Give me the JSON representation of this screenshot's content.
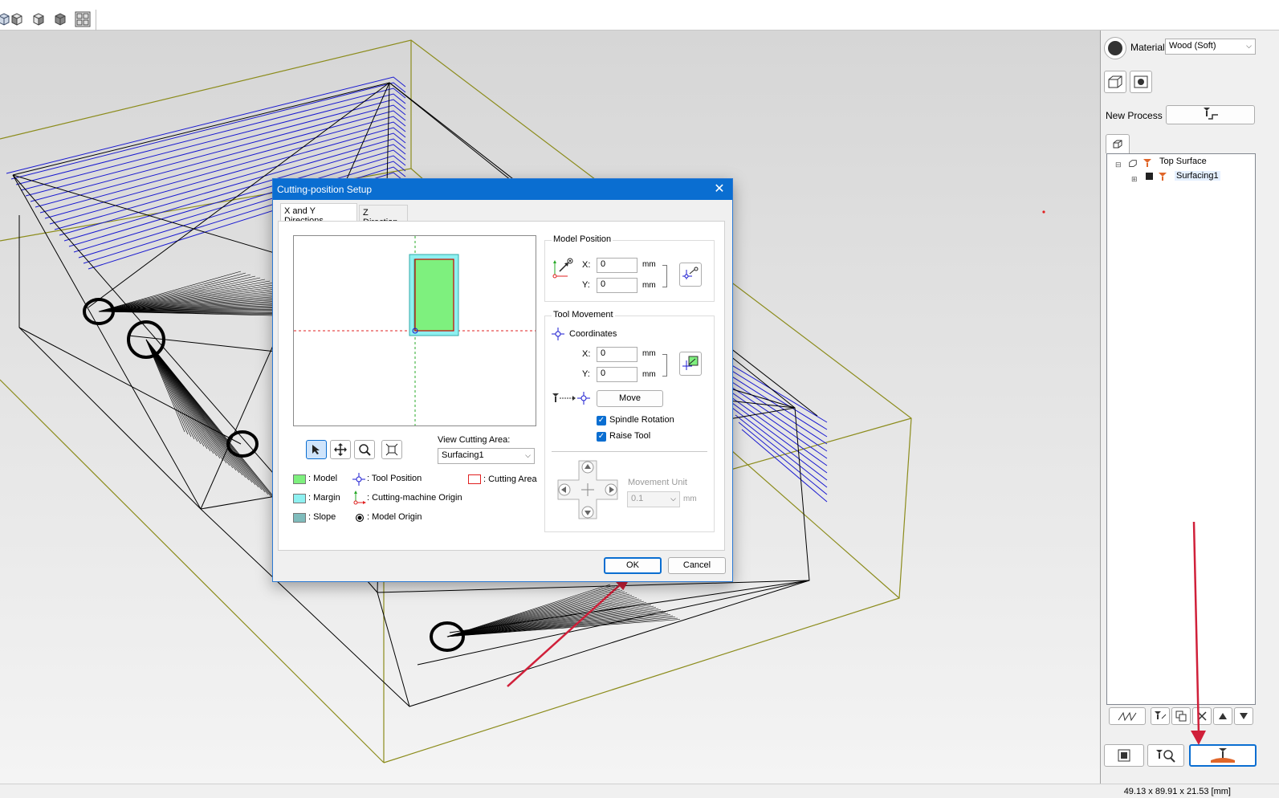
{
  "toolbar": {
    "icons": [
      "view-iso-icon",
      "view-front-icon",
      "view-side-icon",
      "view-back-icon",
      "view-all-icon"
    ]
  },
  "right_panel": {
    "material_label": "Material",
    "material_value": "Wood (Soft)",
    "new_process_label": "New Process",
    "tree": {
      "root_label": "Top Surface",
      "child_label": "Surfacing1"
    }
  },
  "status": {
    "dimensions": "49.13 x 89.91 x 21.53 [mm]"
  },
  "dialog": {
    "title": "Cutting-position Setup",
    "tabs": [
      "X and Y Directions",
      "Z Direction"
    ],
    "model_position": {
      "title": "Model Position",
      "x_label": "X:",
      "x_value": "0",
      "y_label": "Y:",
      "y_value": "0",
      "unit": "mm"
    },
    "tool_movement": {
      "title": "Tool Movement",
      "coordinates_label": "Coordinates",
      "x_label": "X:",
      "x_value": "0",
      "y_label": "Y:",
      "y_value": "0",
      "unit": "mm",
      "move_button": "Move",
      "spindle_rotation": "Spindle Rotation",
      "raise_tool": "Raise Tool",
      "movement_unit_label": "Movement Unit",
      "movement_unit_value": "0.1",
      "movement_unit_unit": "mm"
    },
    "view_cutting_area_label": "View Cutting Area:",
    "view_cutting_area_value": "Surfacing1",
    "legend": {
      "model": ": Model",
      "margin": ": Margin",
      "slope": ": Slope",
      "tool_position": ": Tool Position",
      "machine_origin": ": Cutting-machine Origin",
      "model_origin": ": Model Origin",
      "cutting_area": ": Cutting Area"
    },
    "ok_label": "OK",
    "cancel_label": "Cancel"
  },
  "colors": {
    "accent": "#0a6ed1",
    "annotation_arrow": "#d0203a",
    "model_fill": "#7ef07e",
    "margin_fill": "#8ef0f0",
    "slope_fill": "#7fbcbc",
    "cutting_area": "#e02020",
    "wire_box": "#8c8c1c",
    "toolpath": "#1a1ad0"
  }
}
